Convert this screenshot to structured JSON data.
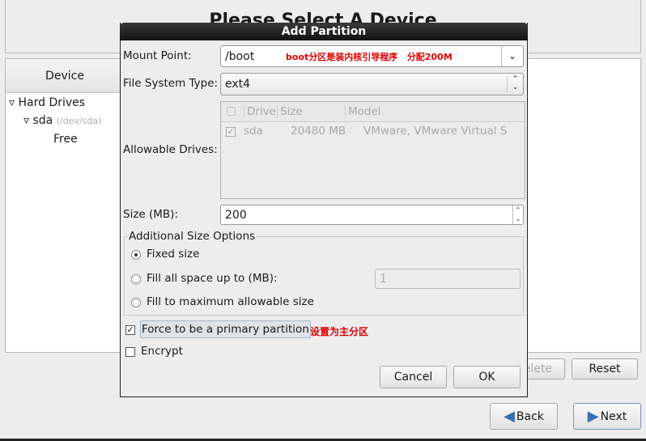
{
  "background": {
    "title": "Please Select A Device",
    "column_device": "Device",
    "tree": [
      {
        "label": "Hard Drives"
      },
      {
        "label": "sda",
        "sub": "(/dev/sda)"
      },
      {
        "label": "Free"
      }
    ],
    "delete_label": "Delete",
    "reset_label": "Reset",
    "back_label": "Back",
    "next_label": "Next"
  },
  "dialog": {
    "title": "Add Partition",
    "mount_point": {
      "label": "Mount Point:",
      "value": "/boot",
      "annotation": "boot分区是装内核引导程序   分配200M"
    },
    "fs_type": {
      "label": "File System Type:",
      "value": "ext4"
    },
    "drives": {
      "label": "Allowable Drives:",
      "headers": [
        "Drive",
        "Size",
        "Model"
      ],
      "rows": [
        {
          "checked": true,
          "drive": "sda",
          "size": "20480 MB",
          "model": "VMware, VMware Virtual S"
        }
      ]
    },
    "size": {
      "label": "Size (MB):",
      "value": "200"
    },
    "size_options": {
      "legend": "Additional Size Options",
      "fixed": "Fixed size",
      "fill_upto": "Fill all space up to (MB):",
      "fill_upto_value": "1",
      "fill_max": "Fill to maximum allowable size",
      "selected": "fixed"
    },
    "primary": {
      "label": "Force to be a primary partition",
      "checked": true,
      "annotation": "设置为主分区"
    },
    "encrypt": {
      "label": "Encrypt",
      "checked": false
    },
    "cancel_label": "Cancel",
    "ok_label": "OK"
  },
  "colors": {
    "annotation": "#e00000",
    "titlebar": "#1e1e1e",
    "arrow": "#3a6fb0"
  }
}
